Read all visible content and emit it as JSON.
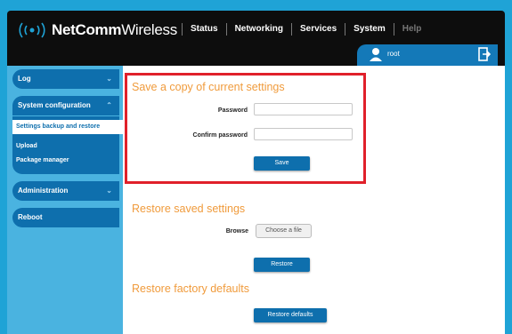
{
  "header": {
    "brand_bold": "NetComm",
    "brand_thin": "Wireless",
    "menu": [
      "Status",
      "Networking",
      "Services",
      "System",
      "Help"
    ],
    "username": "root",
    "logo_icon": "signal-wave-icon",
    "user_icon": "user-icon",
    "logout_icon": "logout-icon"
  },
  "sidebar": {
    "log": "Log",
    "system_configuration": "System configuration",
    "sub_items": [
      "Settings backup and restore",
      "Upload",
      "Package manager"
    ],
    "administration": "Administration",
    "reboot": "Reboot",
    "chevron": "⌄"
  },
  "save_section": {
    "title": "Save a copy of current settings",
    "password_label": "Password",
    "confirm_label": "Confirm password",
    "password_value": "",
    "confirm_value": "",
    "save_button": "Save"
  },
  "restore_section": {
    "title": "Restore saved settings",
    "browse_label": "Browse",
    "choose_file": "Choose a file",
    "restore_button": "Restore"
  },
  "factory_section": {
    "title": "Restore factory defaults",
    "button": "Restore defaults"
  },
  "colors": {
    "accent": "#0e6fad",
    "background": "#1fa3d6",
    "section_title": "#f09b3c",
    "highlight_border": "#e0202a"
  }
}
